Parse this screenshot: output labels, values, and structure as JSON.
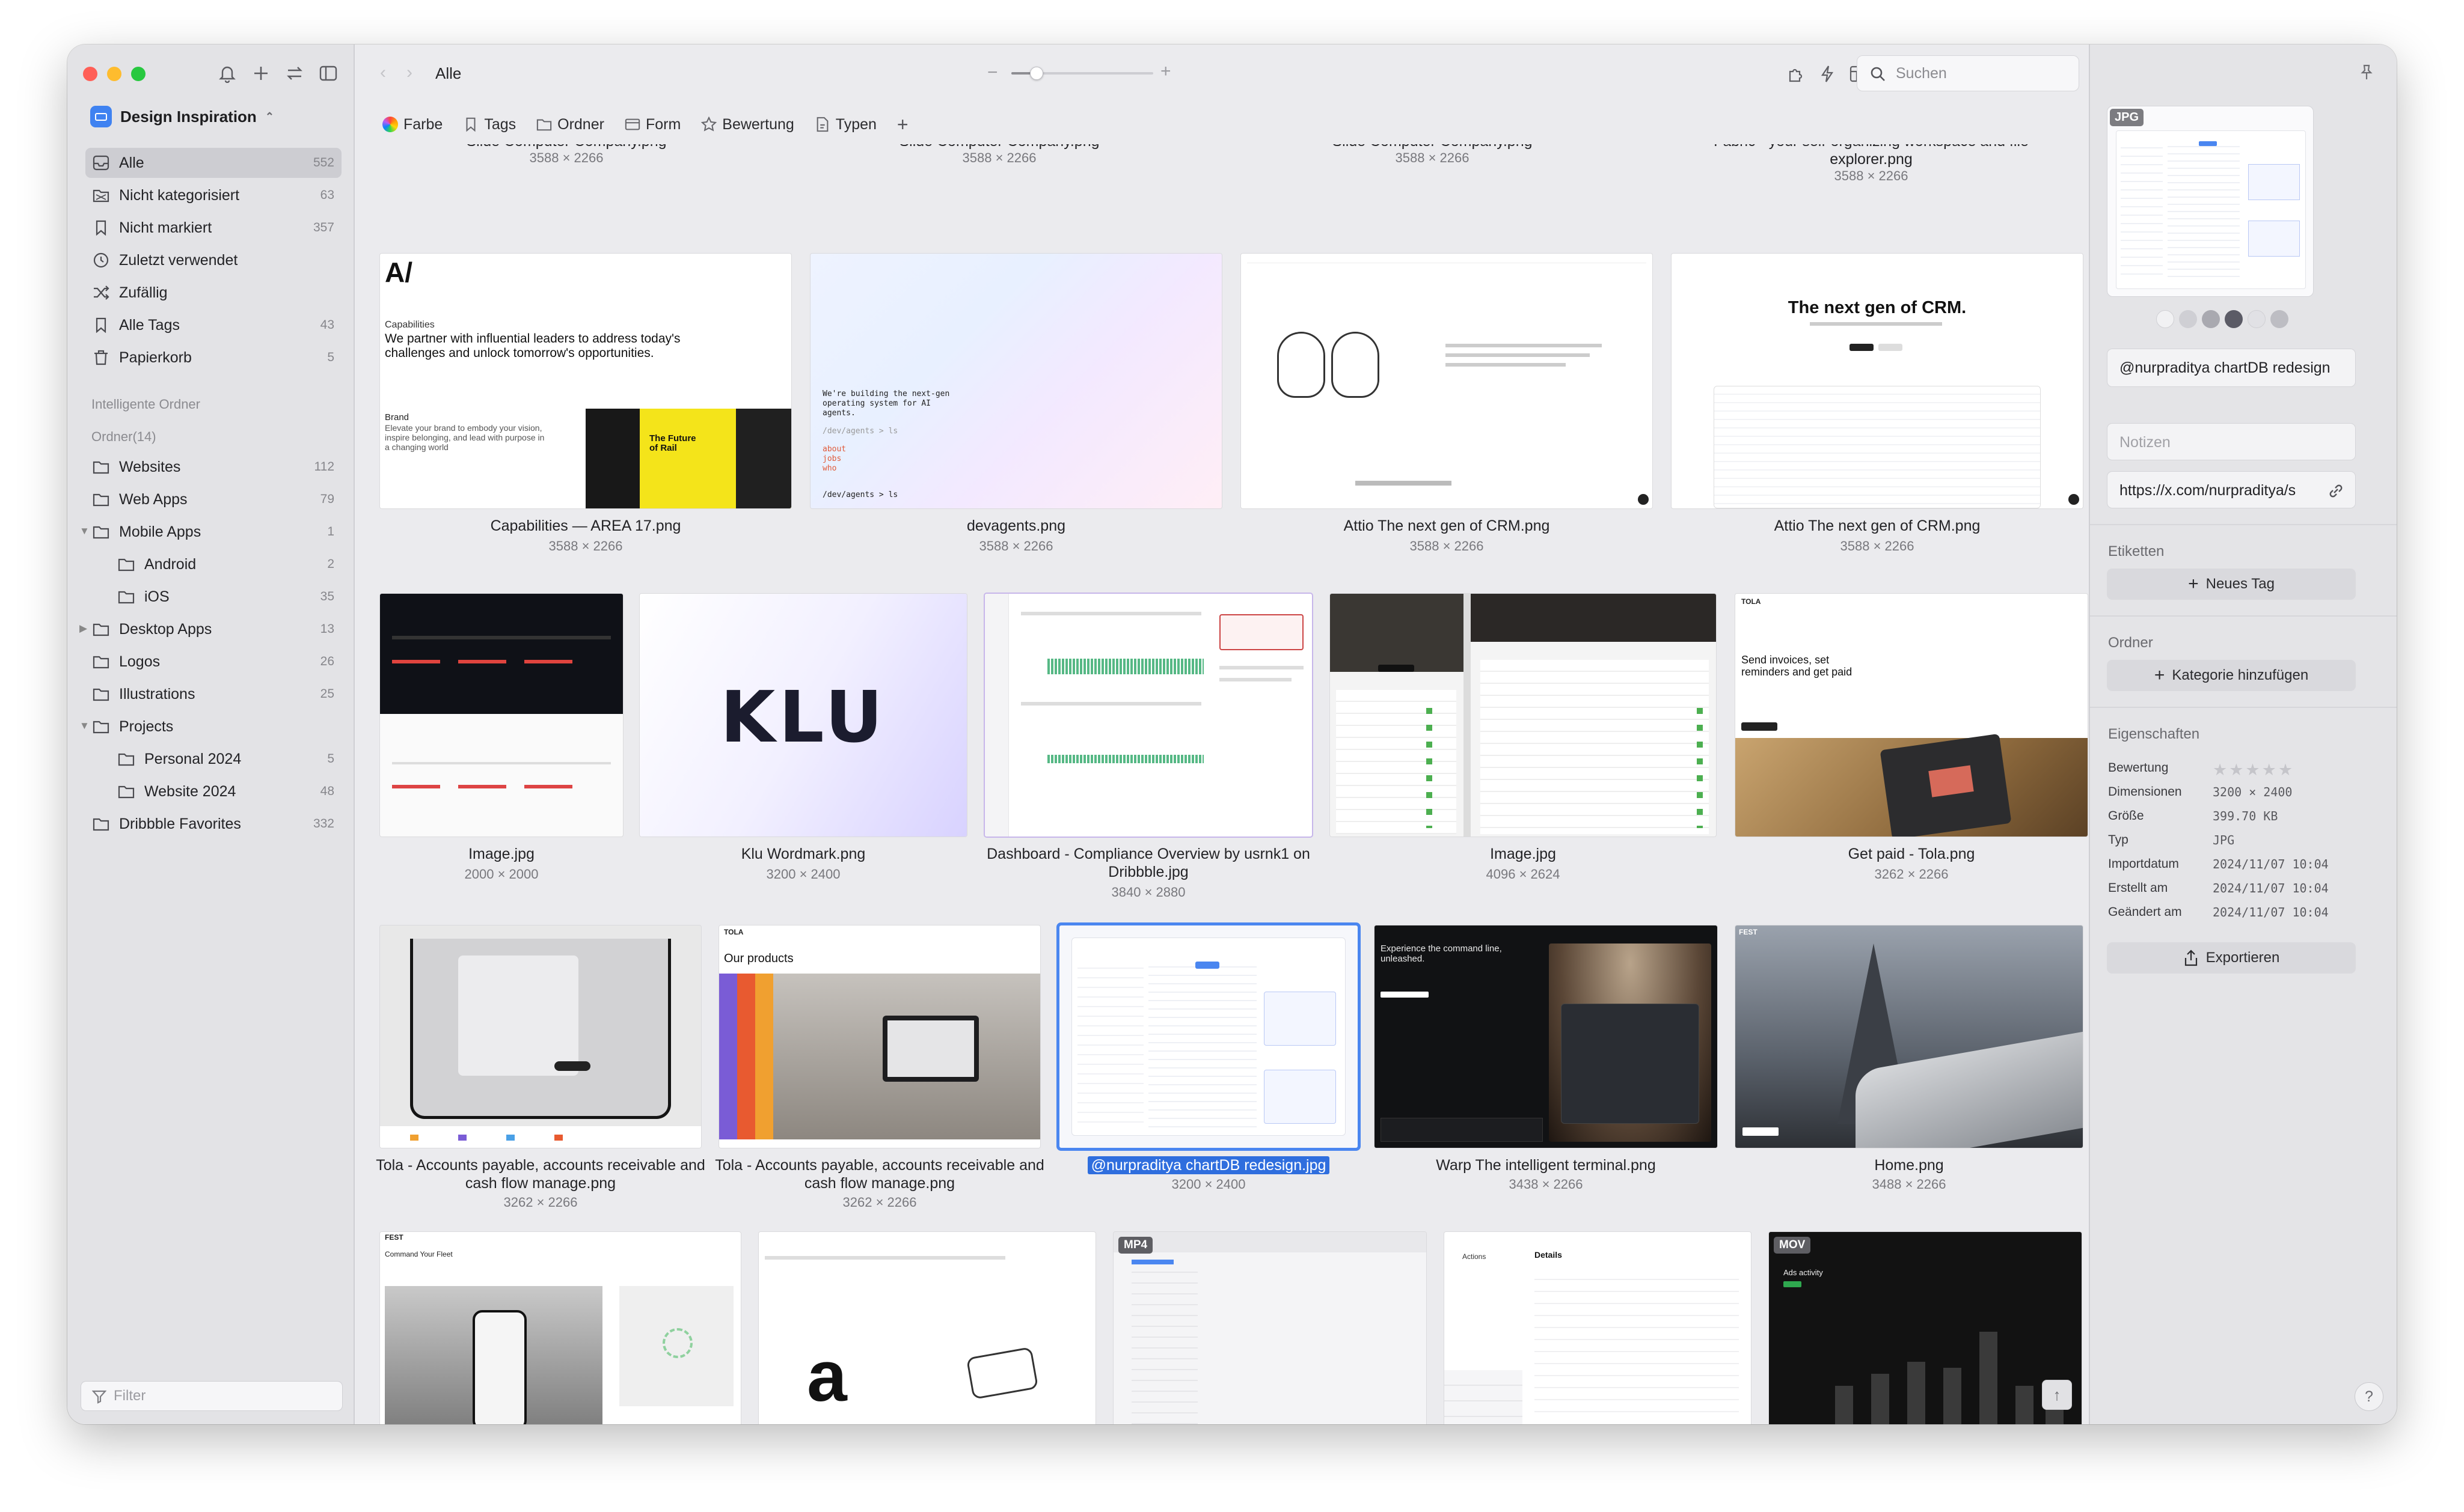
{
  "sidebar": {
    "library_name": "Design Inspiration",
    "items": [
      {
        "label": "Alle",
        "count": "552",
        "icon": "all-items-icon"
      },
      {
        "label": "Nicht kategorisiert",
        "count": "63",
        "icon": "uncategorized-icon"
      },
      {
        "label": "Nicht markiert",
        "count": "357",
        "icon": "untagged-icon"
      },
      {
        "label": "Zuletzt verwendet",
        "count": "",
        "icon": "clock-icon"
      },
      {
        "label": "Zufällig",
        "count": "",
        "icon": "shuffle-icon"
      },
      {
        "label": "Alle Tags",
        "count": "43",
        "icon": "tag-icon"
      },
      {
        "label": "Papierkorb",
        "count": "5",
        "icon": "trash-icon"
      }
    ],
    "smart_folders_label": "Intelligente Ordner",
    "folders_label": "Ordner(14)",
    "folders": [
      {
        "label": "Websites",
        "count": "112"
      },
      {
        "label": "Web Apps",
        "count": "79"
      },
      {
        "label": "Mobile Apps",
        "count": "1"
      },
      {
        "label": "Android",
        "count": "2"
      },
      {
        "label": "iOS",
        "count": "35"
      },
      {
        "label": "Desktop Apps",
        "count": "13"
      },
      {
        "label": "Logos",
        "count": "26"
      },
      {
        "label": "Illustrations",
        "count": "25"
      },
      {
        "label": "Projects",
        "count": ""
      },
      {
        "label": "Personal 2024",
        "count": "5"
      },
      {
        "label": "Website 2024",
        "count": "48"
      },
      {
        "label": "Dribbble Favorites",
        "count": "332"
      }
    ],
    "filter_placeholder": "Filter"
  },
  "toolbar": {
    "breadcrumb": "Alle",
    "zoom_level": 0.18,
    "search_placeholder": "Suchen"
  },
  "filterbar": {
    "items": [
      "Farbe",
      "Tags",
      "Ordner",
      "Form",
      "Bewertung",
      "Typen"
    ]
  },
  "grid": {
    "row0": [
      {
        "caption": "Slide Computer Company.png",
        "dims": "3588 × 2266"
      },
      {
        "caption": "Slide Computer Company.png",
        "dims": "3588 × 2266"
      },
      {
        "caption": "Slide Computer Company.png",
        "dims": "3588 × 2266"
      },
      {
        "caption": "Fabric - your self-organizing workspace and file explorer.png",
        "dims": "3588 × 2266"
      }
    ],
    "row1": [
      {
        "caption": "Capabilities — AREA 17.png",
        "dims": "3588 × 2266"
      },
      {
        "caption": "devagents.png",
        "dims": "3588 × 2266"
      },
      {
        "caption": "Attio The next gen of CRM.png",
        "dims": "3588 × 2266"
      },
      {
        "caption": "Attio The next gen of CRM.png",
        "dims": "3588 × 2266"
      }
    ],
    "row2": [
      {
        "caption": "Image.jpg",
        "dims": "2000 × 2000"
      },
      {
        "caption": "Klu Wordmark.png",
        "dims": "3200 × 2400"
      },
      {
        "caption": "Dashboard - Compliance Overview by usrnk1 on Dribbble.jpg",
        "dims": "3840 × 2880"
      },
      {
        "caption": "Image.jpg",
        "dims": "4096 × 2624"
      },
      {
        "caption": "Get paid - Tola.png",
        "dims": "3262 × 2266"
      }
    ],
    "row3": [
      {
        "caption": "Tola - Accounts payable, accounts receivable and cash flow manage.png",
        "dims": "3262 × 2266"
      },
      {
        "caption": "Tola - Accounts payable, accounts receivable and cash flow manage.png",
        "dims": "3262 × 2266"
      },
      {
        "caption": "@nurpraditya chartDB redesign.jpg",
        "dims": "3200 × 2400"
      },
      {
        "caption": "Warp The intelligent terminal.png",
        "dims": "3438 × 2266"
      },
      {
        "caption": "Home.png",
        "dims": "3488 × 2266"
      }
    ],
    "row4_badges": [
      "MP4",
      "MOV"
    ]
  },
  "thumbs": {
    "area17_logo": "A/",
    "area17_heading": "Capabilities",
    "area17_text": "We partner with influential leaders to address today's challenges and unlock tomorrow's opportunities.",
    "area17_brand": "Brand",
    "area17_brand_text": "Elevate your brand to embody your vision, inspire belonging, and lead with purpose in a changing world",
    "area17_future": "The Future of Rail",
    "dev_text": "We're building the next-gen operating system for AI agents.",
    "dev_prompt": "/dev/agents > ls",
    "dev_links": [
      "about",
      "jobs",
      "who"
    ],
    "attio_headline": "The next gen of CRM.",
    "klu": "KLU",
    "tola_text": "Send invoices, set reminders and get paid",
    "tola_products": "Our products",
    "tola_brand": "TOLA",
    "warp_title": "Experience the command line, unleashed.",
    "details_title": "Details",
    "details_actions": "Actions",
    "ads_title": "Ads activity",
    "fest_title": "Command Your Fleet",
    "fest_brand": "FEST"
  },
  "inspector": {
    "type_badge": "JPG",
    "title": "@nurpraditya chartDB redesign",
    "notes_placeholder": "Notizen",
    "url": "https://x.com/nurpraditya/s",
    "tags_header": "Etiketten",
    "new_tag": "Neues Tag",
    "folders_header": "Ordner",
    "add_category": "Kategorie hinzufügen",
    "props_header": "Eigenschaften",
    "props": [
      {
        "key": "Bewertung",
        "value": ""
      },
      {
        "key": "Dimensionen",
        "value": "3200 × 2400"
      },
      {
        "key": "Größe",
        "value": "399.70 KB"
      },
      {
        "key": "Typ",
        "value": "JPG"
      },
      {
        "key": "Importdatum",
        "value": "2024/11/07 10:04"
      },
      {
        "key": "Erstellt am",
        "value": "2024/11/07 10:04"
      },
      {
        "key": "Geändert am",
        "value": "2024/11/07 10:04"
      }
    ],
    "rating": "★★★★★",
    "export": "Exportieren",
    "help": "?",
    "swatch_colors": [
      "#f1f1f3",
      "#cfcfd4",
      "#a9a9b0",
      "#5b5b66",
      "#e1e1e5",
      "#bdbdc3"
    ]
  },
  "colors": {
    "accent": "#3f82f1",
    "selection": "#2f6ede"
  }
}
